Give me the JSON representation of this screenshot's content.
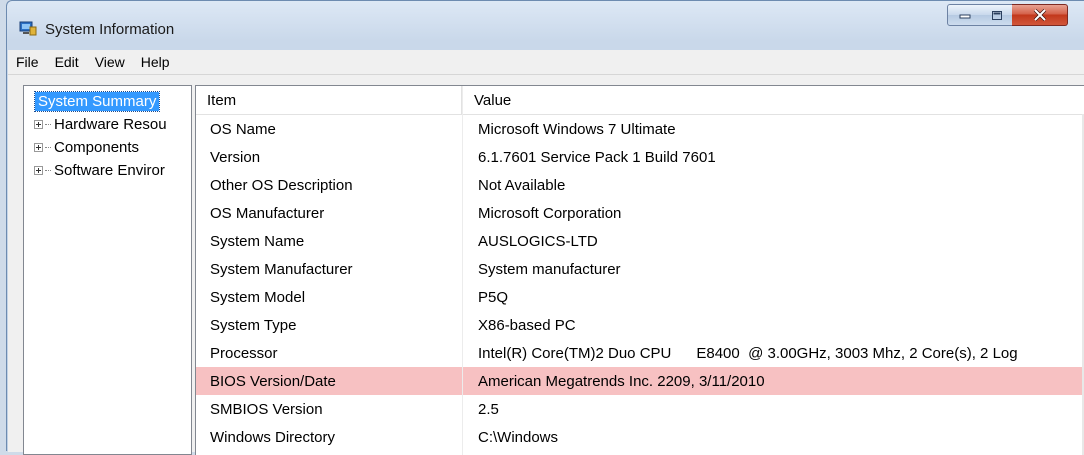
{
  "window": {
    "title": "System Information",
    "app_icon": "system-information-icon"
  },
  "caption_buttons": {
    "minimize": "minimize-icon",
    "maximize": "maximize-icon",
    "close": "close-icon"
  },
  "menu": {
    "items": [
      "File",
      "Edit",
      "View",
      "Help"
    ]
  },
  "tree": {
    "root": "System Summary",
    "children": [
      "Hardware Resou",
      "Components",
      "Software Enviror"
    ]
  },
  "table": {
    "columns": [
      "Item",
      "Value"
    ],
    "rows": [
      {
        "item": "OS Name",
        "value": "Microsoft Windows 7 Ultimate"
      },
      {
        "item": "Version",
        "value": "6.1.7601 Service Pack 1 Build 7601"
      },
      {
        "item": "Other OS Description",
        "value": "Not Available"
      },
      {
        "item": "OS Manufacturer",
        "value": "Microsoft Corporation"
      },
      {
        "item": "System Name",
        "value": "AUSLOGICS-LTD"
      },
      {
        "item": "System Manufacturer",
        "value": "System manufacturer"
      },
      {
        "item": "System Model",
        "value": "P5Q"
      },
      {
        "item": "System Type",
        "value": "X86-based PC"
      },
      {
        "item": "Processor",
        "value": "Intel(R) Core(TM)2 Duo CPU      E8400  @ 3.00GHz, 3003 Mhz, 2 Core(s), 2 Log"
      },
      {
        "item": "BIOS Version/Date",
        "value": "American Megatrends Inc. 2209, 3/11/2010"
      },
      {
        "item": "SMBIOS Version",
        "value": "2.5"
      },
      {
        "item": "Windows Directory",
        "value": "C:\\Windows"
      }
    ],
    "highlighted_row_index": 9
  },
  "colors": {
    "highlight_row": "#f7c1c2",
    "tree_selection": "#3399ff",
    "close_button": "#c9442a"
  }
}
